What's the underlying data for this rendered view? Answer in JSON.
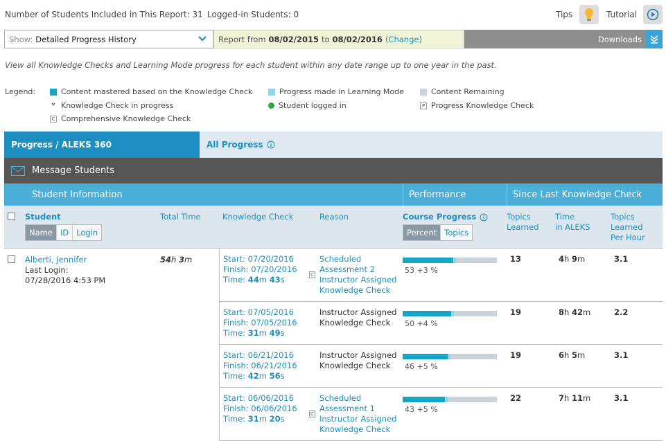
{
  "header": {
    "students_included": "Number of Students Included in This Report: 31",
    "logged_in": "Logged-in Students: 0",
    "tips": "Tips",
    "tutorial": "Tutorial"
  },
  "toolbar": {
    "show_label": "Show:",
    "show_value": "Detailed Progress History",
    "report_from": "Report from",
    "date_from": "08/02/2015",
    "to": "to",
    "date_to": "08/02/2016",
    "change": "(Change)",
    "downloads": "Downloads"
  },
  "description": "View all Knowledge Checks and Learning Mode progress for each student within any date range up to one year in the past.",
  "legend": {
    "title": "Legend:",
    "mastered": "Content mastered based on the Knowledge Check",
    "learning": "Progress made in Learning Mode",
    "remaining": "Content Remaining",
    "in_progress": "Knowledge Check in progress",
    "logged_in": "Student logged in",
    "progress_kc": "Progress Knowledge Check",
    "comprehensive": "Comprehensive Knowledge Check",
    "colors": {
      "mastered": "#15a5c5",
      "learning": "#8fd6e6",
      "remaining": "#c8d4da",
      "logged": "#2aa84a"
    }
  },
  "tabs": {
    "active": "Progress / ALEKS 360",
    "other": "All Progress"
  },
  "message_students": "Message Students",
  "groups": {
    "student_info": "Student Information",
    "performance": "Performance",
    "since": "Since Last Knowledge Check"
  },
  "columns": {
    "student": "Student",
    "name": "Name",
    "id": "ID",
    "login": "Login",
    "total_time": "Total Time",
    "knowledge_check": "Knowledge Check",
    "reason": "Reason",
    "course_progress": "Course Progress",
    "percent": "Percent",
    "topics": "Topics",
    "topics_learned_1": "Topics",
    "topics_learned_2": "Learned",
    "time_1": "Time",
    "time_2": "in ALEKS",
    "tph_1": "Topics",
    "tph_2": "Learned",
    "tph_3": "Per Hour"
  },
  "student": {
    "name": "Alberti, Jennifer",
    "last_login_label": "Last Login:",
    "last_login": "07/28/2016 4:53 PM",
    "total_h": "54",
    "total_m": "3"
  },
  "rows": [
    {
      "start": "07/20/2016",
      "finish": "07/20/2016",
      "time_m": "44",
      "time_s": "43",
      "reason": [
        "Scheduled",
        "Assessment 2",
        "Instructor Assigned",
        "Knowledge Check"
      ],
      "reason_link": true,
      "comprehensive": true,
      "mastered": 53,
      "gain": 3,
      "pct_text": "53 +3 %",
      "topics": "13",
      "h": "4",
      "m": "9",
      "tph": "3.1"
    },
    {
      "start": "07/05/2016",
      "finish": "07/05/2016",
      "time_m": "31",
      "time_s": "49",
      "reason": [
        "Instructor Assigned",
        "Knowledge Check"
      ],
      "reason_link": false,
      "comprehensive": false,
      "mastered": 50,
      "gain": 4,
      "pct_text": "50 +4 %",
      "topics": "19",
      "h": "8",
      "m": "42",
      "tph": "2.2"
    },
    {
      "start": "06/21/2016",
      "finish": "06/21/2016",
      "time_m": "42",
      "time_s": "56",
      "reason": [
        "Instructor Assigned",
        "Knowledge Check"
      ],
      "reason_link": false,
      "comprehensive": false,
      "mastered": 46,
      "gain": 5,
      "pct_text": "46 +5 %",
      "topics": "19",
      "h": "6",
      "m": "5",
      "tph": "3.1"
    },
    {
      "start": "06/06/2016",
      "finish": "06/06/2016",
      "time_m": "31",
      "time_s": "20",
      "reason": [
        "Scheduled",
        "Assessment 1",
        "Instructor Assigned",
        "Knowledge Check"
      ],
      "reason_link": true,
      "comprehensive": true,
      "mastered": 43,
      "gain": 5,
      "pct_text": "43 +5 %",
      "topics": "22",
      "h": "7",
      "m": "11",
      "tph": "3.1"
    }
  ],
  "labels": {
    "start": "Start: ",
    "finish": "Finish: ",
    "time": "Time: ",
    "h": "h",
    "m": "m",
    "s": "s",
    "c": "C",
    "p": "P",
    "star": "*"
  }
}
